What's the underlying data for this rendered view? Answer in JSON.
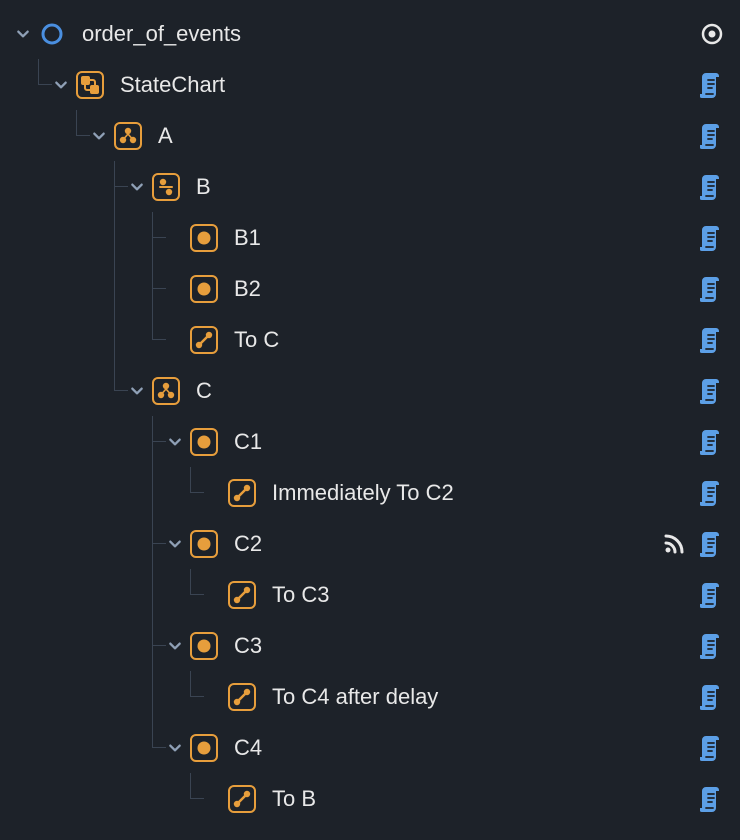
{
  "colors": {
    "orange": "#e79e3c",
    "blue": "#5c9fe6",
    "grey": "#8fa0b6",
    "text": "#e8e8e8"
  },
  "tree": [
    {
      "id": "root",
      "depth": 0,
      "expanded": true,
      "icon": "ring-blue",
      "label": "order_of_events",
      "hasScript": false,
      "hasVisibility": true,
      "isLast": true
    },
    {
      "id": "statechart",
      "depth": 1,
      "expanded": true,
      "icon": "statechart",
      "label": "StateChart",
      "hasScript": true,
      "isLast": true
    },
    {
      "id": "a",
      "depth": 2,
      "expanded": true,
      "icon": "parallel",
      "label": "A",
      "hasScript": true,
      "isLast": true
    },
    {
      "id": "b",
      "depth": 3,
      "expanded": true,
      "icon": "compound-split",
      "label": "B",
      "hasScript": true,
      "isLast": false
    },
    {
      "id": "b1",
      "depth": 4,
      "expanded": null,
      "parentLines": [
        false
      ],
      "icon": "atomic",
      "label": "B1",
      "hasScript": true,
      "isLast": false
    },
    {
      "id": "b2",
      "depth": 4,
      "expanded": null,
      "parentLines": [
        false
      ],
      "icon": "atomic",
      "label": "B2",
      "hasScript": true,
      "isLast": false
    },
    {
      "id": "toc",
      "depth": 4,
      "expanded": null,
      "parentLines": [
        false
      ],
      "icon": "transition",
      "label": "To C",
      "hasScript": true,
      "isLast": true
    },
    {
      "id": "c",
      "depth": 3,
      "expanded": true,
      "icon": "parallel",
      "label": "C",
      "hasScript": true,
      "isLast": true
    },
    {
      "id": "c1",
      "depth": 4,
      "expanded": true,
      "icon": "atomic",
      "label": "C1",
      "hasScript": true,
      "isLast": false
    },
    {
      "id": "imm",
      "depth": 5,
      "expanded": null,
      "parentLines": [
        false
      ],
      "icon": "transition",
      "label": "Immediately To C2",
      "hasScript": true,
      "isLast": true
    },
    {
      "id": "c2",
      "depth": 4,
      "expanded": true,
      "icon": "atomic",
      "label": "C2",
      "hasScript": true,
      "hasSignal": true,
      "isLast": false
    },
    {
      "id": "toc3",
      "depth": 5,
      "expanded": null,
      "parentLines": [
        false
      ],
      "icon": "transition",
      "label": "To C3",
      "hasScript": true,
      "isLast": true
    },
    {
      "id": "c3",
      "depth": 4,
      "expanded": true,
      "icon": "atomic",
      "label": "C3",
      "hasScript": true,
      "isLast": false
    },
    {
      "id": "toc4",
      "depth": 5,
      "expanded": null,
      "parentLines": [
        false
      ],
      "icon": "transition",
      "label": "To C4 after delay",
      "hasScript": true,
      "isLast": true
    },
    {
      "id": "c4",
      "depth": 4,
      "expanded": true,
      "icon": "atomic",
      "label": "C4",
      "hasScript": true,
      "isLast": true
    },
    {
      "id": "tob",
      "depth": 5,
      "expanded": null,
      "icon": "transition",
      "label": "To B",
      "hasScript": true,
      "isLast": true
    }
  ]
}
